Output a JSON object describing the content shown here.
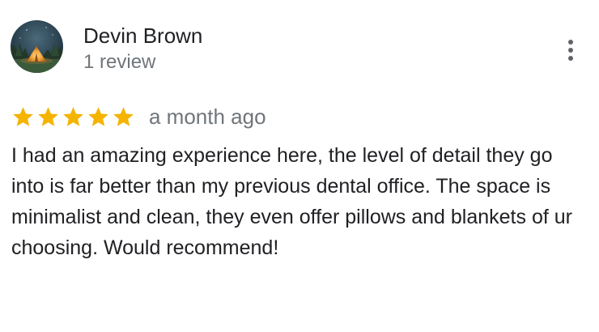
{
  "reviewer": {
    "name": "Devin Brown",
    "review_count": "1 review",
    "avatar": "tent-campsite-avatar"
  },
  "menu": {
    "icon": "more-vert-icon"
  },
  "rating": {
    "stars": 5,
    "max_stars": 5,
    "star_color": "#f4b400",
    "icon": "star-icon"
  },
  "review": {
    "date": "a month ago",
    "text": "I had an amazing experience here, the level of detail they go into is far better than my previous dental office. The space is minimalist and clean, they even offer pillows and blankets of ur choosing. Would recommend!"
  }
}
